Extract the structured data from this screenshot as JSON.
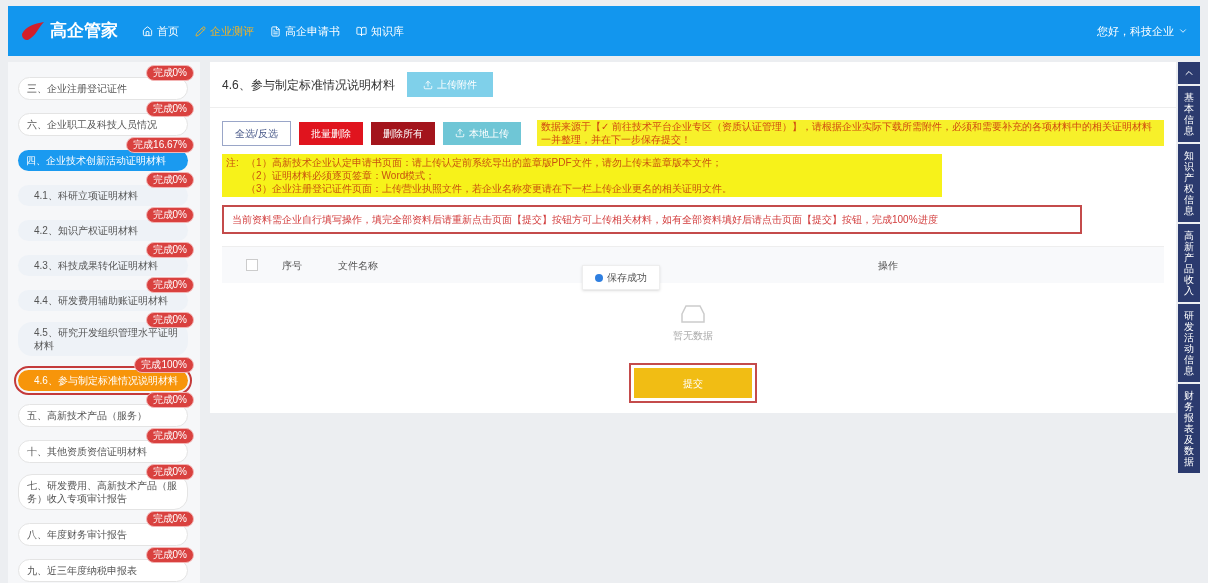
{
  "header": {
    "logo": "高企管家",
    "nav": [
      {
        "label": "首页",
        "selected": false
      },
      {
        "label": "企业测评",
        "selected": true
      },
      {
        "label": "高企申请书",
        "selected": false
      },
      {
        "label": "知识库",
        "selected": false
      }
    ],
    "user": "您好，科技企业"
  },
  "sidebar": {
    "items": [
      {
        "label": "三、企业注册登记证件",
        "badge": "完成0%",
        "expanded": false,
        "selected": false
      },
      {
        "label": "六、企业职工及科技人员情况",
        "badge": "完成0%",
        "expanded": false,
        "selected": false
      },
      {
        "label": "四、企业技术创新活动证明材料",
        "badge": "完成16.67%",
        "expanded": true,
        "selected": false,
        "children": [
          {
            "label": "4.1、科研立项证明材料",
            "badge": "完成0%",
            "selected": false
          },
          {
            "label": "4.2、知识产权证明材料",
            "badge": "完成0%",
            "selected": false
          },
          {
            "label": "4.3、科技成果转化证明材料",
            "badge": "完成0%",
            "selected": false
          },
          {
            "label": "4.4、研发费用辅助账证明材料",
            "badge": "完成0%",
            "selected": false
          },
          {
            "label": "4.5、研究开发组织管理水平证明材料",
            "badge": "完成0%",
            "selected": false
          },
          {
            "label": "4.6、参与制定标准情况说明材料",
            "badge": "完成100%",
            "selected": true
          }
        ]
      },
      {
        "label": "五、高新技术产品（服务）",
        "badge": "完成0%",
        "expanded": false,
        "selected": false
      },
      {
        "label": "十、其他资质资信证明材料",
        "badge": "完成0%",
        "expanded": false,
        "selected": false
      },
      {
        "label": "七、研发费用、高新技术产品（服务）收入专项审计报告",
        "badge": "完成0%",
        "expanded": false,
        "selected": false
      },
      {
        "label": "八、年度财务审计报告",
        "badge": "完成0%",
        "expanded": false,
        "selected": false
      },
      {
        "label": "九、近三年度纳税申报表",
        "badge": "完成0%",
        "expanded": false,
        "selected": false
      }
    ]
  },
  "main": {
    "title": "4.6、参与制定标准情况说明材料",
    "upload_button": "上传附件",
    "toolbar": [
      {
        "label": "全选/反选",
        "kind": "outline"
      },
      {
        "label": "批量删除",
        "kind": "danger"
      },
      {
        "label": "删除所有",
        "kind": "dark"
      },
      {
        "label": "本地上传",
        "kind": "upload"
      }
    ],
    "source_note": "数据来源于【✓ 前往技术平台企业专区（资质认证管理）】，请根据企业实际下载所需附件，必须和需要补充的各项材料中的相关证明材料一并整理，并在下一步保存提交！",
    "notes_label": "注:",
    "notes": [
      "（1）高新技术企业认定申请书页面：请上传认定前系统导出的盖章版PDF文件，请勿上传未盖章版本文件；",
      "（2）证明材料必须逐页签章：Word模式；",
      "（3）企业注册登记证件页面：上传营业执照文件，若企业名称变更请在下一栏上传企业更名的相关证明文件。"
    ],
    "warning": "当前资料需企业自行填写操作，填完全部资料后请重新点击页面【提交】按钮方可上传相关材料，如有全部资料填好后请点击页面【提交】按钮，完成100%进度",
    "table": {
      "select_all_checked": false,
      "columns": [
        "序号",
        "文件名称",
        "操作"
      ],
      "empty": "暂无数据"
    },
    "toast": "保存成功",
    "submit": "提交"
  },
  "side_tabs": [
    "基本信息",
    "知识产权信息",
    "高新产品收入",
    "研发活动信息",
    "财务报表及数据"
  ]
}
